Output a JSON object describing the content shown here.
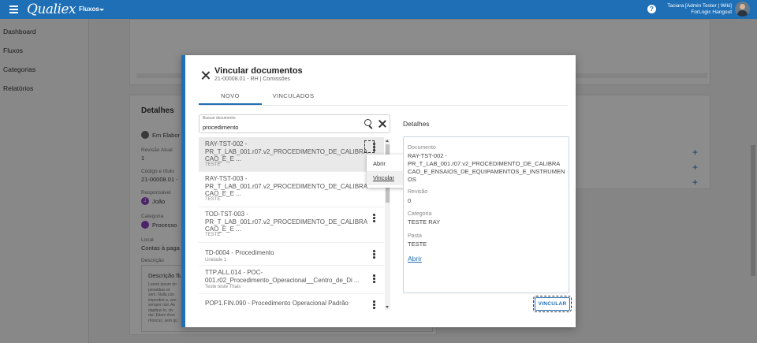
{
  "topbar": {
    "logo": "Qualiex",
    "nav_label": "Fluxos",
    "user_name": "Taciara [Admin Tester | Wiki]",
    "user_org": "ForLogic Hangout",
    "help_icon": "?"
  },
  "sidebar": {
    "items": [
      {
        "label": "Dashboard"
      },
      {
        "label": "Fluxos"
      },
      {
        "label": "Categorias"
      },
      {
        "label": "Relatórios"
      }
    ]
  },
  "background": {
    "detalhes_title": "Detalhes",
    "status": "Em Elabor",
    "revisao_label": "Revisão Atual",
    "revisao_value": "1",
    "codigo_label": "Código e título",
    "codigo_value": "21-00008.01 -",
    "responsavel_label": "Responsável",
    "responsavel_value": "João",
    "responsavel_initial": "J",
    "categoria_label": "Categoria",
    "categoria_value": "Processo",
    "local_label": "Local",
    "local_value": "Contas à paga",
    "descricao_label": "Descrição",
    "descricao_title": "Descrição flu",
    "descricao_lines": [
      "Lorem ipsum do",
      "penatibus et",
      "sem. Nulla con",
      "imperdiet a, ven",
      "semper nisi. Ae",
      "dapibus in, viv",
      "dui. Etiam rhon",
      "rhoncus, sem qu"
    ]
  },
  "modal": {
    "title": "Vincular documentos",
    "subtitle": "21-00008.01 - RH | Comissões",
    "tabs": [
      {
        "label": "NOVO",
        "active": true
      },
      {
        "label": "VINCULADOS",
        "active": false
      }
    ],
    "search": {
      "label": "Buscar documento",
      "value": "procedimento"
    },
    "results": [
      {
        "title": "RAY-TST-002 - PR_T_LAB_001.r07.v2_PROCEDIMENTO_DE_CALIBRACAO_E_E ...",
        "lines": [
          "RAY-TST-002 -",
          "PR_T_LAB_001.r07.v2_PROCEDIMENTO_DE_CALIBRA",
          "CAO_E_E ..."
        ],
        "sub": "TESTE",
        "selected": true
      },
      {
        "title": "RAY-TST-003 - PR_T_LAB_001.r07.v2_PROCEDIMENTO_DE_CALIBRACAO_E_E ...",
        "lines": [
          "RAY-TST-003 -",
          "PR_T_LAB_001.r07.v2_PROCEDIMENTO_DE_CALIBRA",
          "CAO_E_E ..."
        ],
        "sub": "TESTE",
        "selected": false
      },
      {
        "title": "TOD-TST-003 - PR_T_LAB_001.r07.v2_PROCEDIMENTO_DE_CALIBRACAO_E_E ...",
        "lines": [
          "TOD-TST-003 -",
          "PR_T_LAB_001.r07.v2_PROCEDIMENTO_DE_CALIBRA",
          "CAO_E_E ..."
        ],
        "sub": "TESTE",
        "selected": false
      },
      {
        "title": "TD-0004 - Procedimento",
        "lines": [
          "TD-0004 - Procedimento"
        ],
        "sub": "Unidade 1",
        "selected": false
      },
      {
        "title": "TTP.ALL.014 - POC-001.r02_Procedimento_Operacional__Centro_de_Di ...",
        "lines": [
          "TTP.ALL.014 - POC-",
          "001.r02_Procedimento_Operacional__Centro_de_Di ..."
        ],
        "sub": "Teste teste Thais",
        "selected": false
      },
      {
        "title": "POP1.FIN.090 - Procedimento Operacional Padrão",
        "lines": [
          "POP1.FIN.090 - Procedimento Operacional Padrão"
        ],
        "sub": "",
        "selected": false
      }
    ],
    "context_menu": {
      "items": [
        {
          "label": "Abrir"
        },
        {
          "label": "Vincular"
        }
      ]
    },
    "details": {
      "title": "Detalhes",
      "documento_label": "Documento",
      "documento_lines": [
        "RAY-TST-002 -",
        "PR_T_LAB_001.r07.v2_PROCEDIMENTO_DE_CALIBRA",
        "CAO_E_ENSAIOS_DE_EQUIPAMENTOS_E_INSTRUMEN",
        "OS"
      ],
      "revisao_label": "Revisão",
      "revisao_value": "0",
      "categoria_label": "Categoria",
      "categoria_value": "TESTE RAY",
      "pasta_label": "Pasta",
      "pasta_value": "TESTE",
      "link_label": "Abrir"
    },
    "action_button": "VINCULAR"
  },
  "colors": {
    "primary": "#1e6fb6",
    "overlay": "rgba(0,0,0,0.45)"
  }
}
